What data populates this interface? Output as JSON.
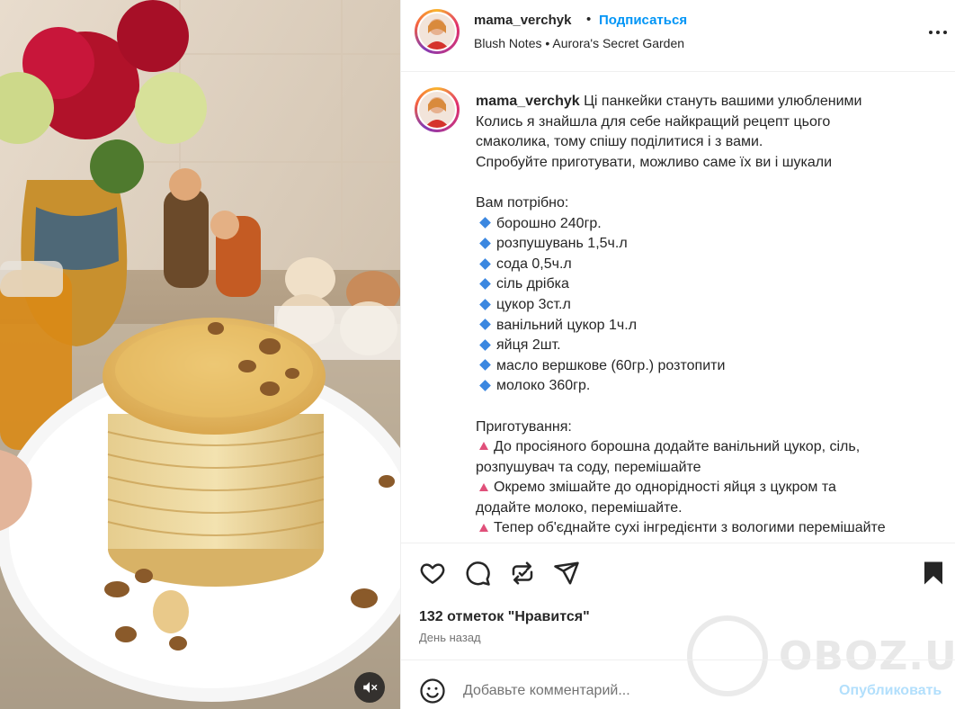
{
  "header": {
    "username": "mama_verchyk",
    "separator": "•",
    "follow_label": "Подписаться",
    "music": "Blush Notes • Aurora's Secret Garden",
    "more_icon": "more-horizontal-icon"
  },
  "caption": {
    "username": "mama_verchyk",
    "lines": [
      "Ці панкейки стануть вашими улюбленими",
      "Колись я знайшла для себе найкращий рецепт цього",
      "смаколика, тому спішу поділитися і з вами.",
      "Спробуйте приготувати, можливо саме їх ви і шукали"
    ],
    "ingredients_title": "Вам потрібно:",
    "ingredients": [
      "борошно 240гр.",
      "розпушувань 1,5ч.л",
      "сода 0,5ч.л",
      "сіль дрібка",
      "цукор 3ст.л",
      "ванільний цукор 1ч.л",
      "яйця 2шт.",
      "масло вершкове (60гр.) розтопити",
      "молоко 360гр."
    ],
    "steps_title": "Приготування:",
    "steps": [
      "До просіяного борошна додайте ванільний цукор, сіль,",
      "розпушувач та соду, перемішайте",
      "Окремо змішайте до однорідності яйця з цукром та",
      "додайте молоко, перемішайте.",
      "Тепер об'єднайте сухі інгредієнти з вологими перемішайте"
    ],
    "bullet_colors": {
      "ingredient": "#3b87e0",
      "step": "#e0507a"
    }
  },
  "actions": {
    "icons": [
      "heart-icon",
      "comment-icon",
      "repost-icon",
      "share-icon",
      "bookmark-icon"
    ],
    "likes": "132 отметок \"Нравится\"",
    "time": "День назад"
  },
  "watermark": {
    "text": "OBOZ.UA"
  },
  "comment": {
    "placeholder": "Добавьте комментарий...",
    "post_label": "Опубликовать",
    "emoji_icon": "emoji-icon"
  },
  "media": {
    "mute_icon": "volume-muted-icon"
  },
  "colors": {
    "accent": "#0095f6",
    "post_disabled": "#b2dffc",
    "text": "#262626",
    "muted": "#737373"
  }
}
